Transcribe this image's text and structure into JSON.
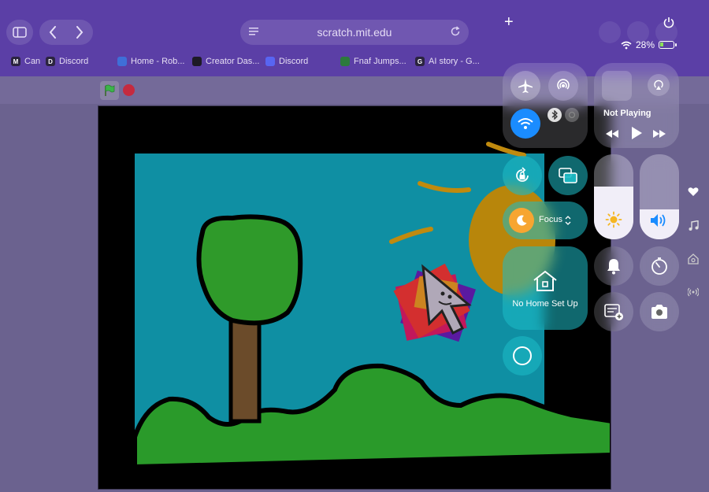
{
  "browser": {
    "url": "scratch.mit.edu",
    "bookmarks": [
      {
        "favicon": "M",
        "label": "Can"
      },
      {
        "favicon": "D",
        "label": "Discord"
      },
      {
        "favicon": "",
        "label": "Home - Rob..."
      },
      {
        "favicon": "",
        "label": "Creator Das..."
      },
      {
        "favicon": "",
        "label": "Discord"
      },
      {
        "favicon": "",
        "label": "Fnaf Jumps..."
      },
      {
        "favicon": "G",
        "label": "AI story - G..."
      }
    ],
    "new_tab_symbol": "+"
  },
  "status_bar": {
    "battery_percent": "28%",
    "battery_level": 0.28,
    "wifi": true,
    "charging": true
  },
  "scratch": {
    "green_flag_icon": "green-flag-icon",
    "stop_icon": "stop-icon",
    "stage_scene": "tree, hills, sun, sprite-on-sky"
  },
  "control_center": {
    "airplane_mode": false,
    "airdrop": true,
    "wifi": true,
    "bluetooth": true,
    "now_playing": "Not Playing",
    "focus_label": "Focus",
    "home_label": "No Home Set Up",
    "brightness_level": 0.62,
    "volume_level": 0.35,
    "colors": {
      "accent_blue": "#1a8cff",
      "teal_tile": "#1ebec8",
      "focus_orange": "#f7a531"
    }
  }
}
